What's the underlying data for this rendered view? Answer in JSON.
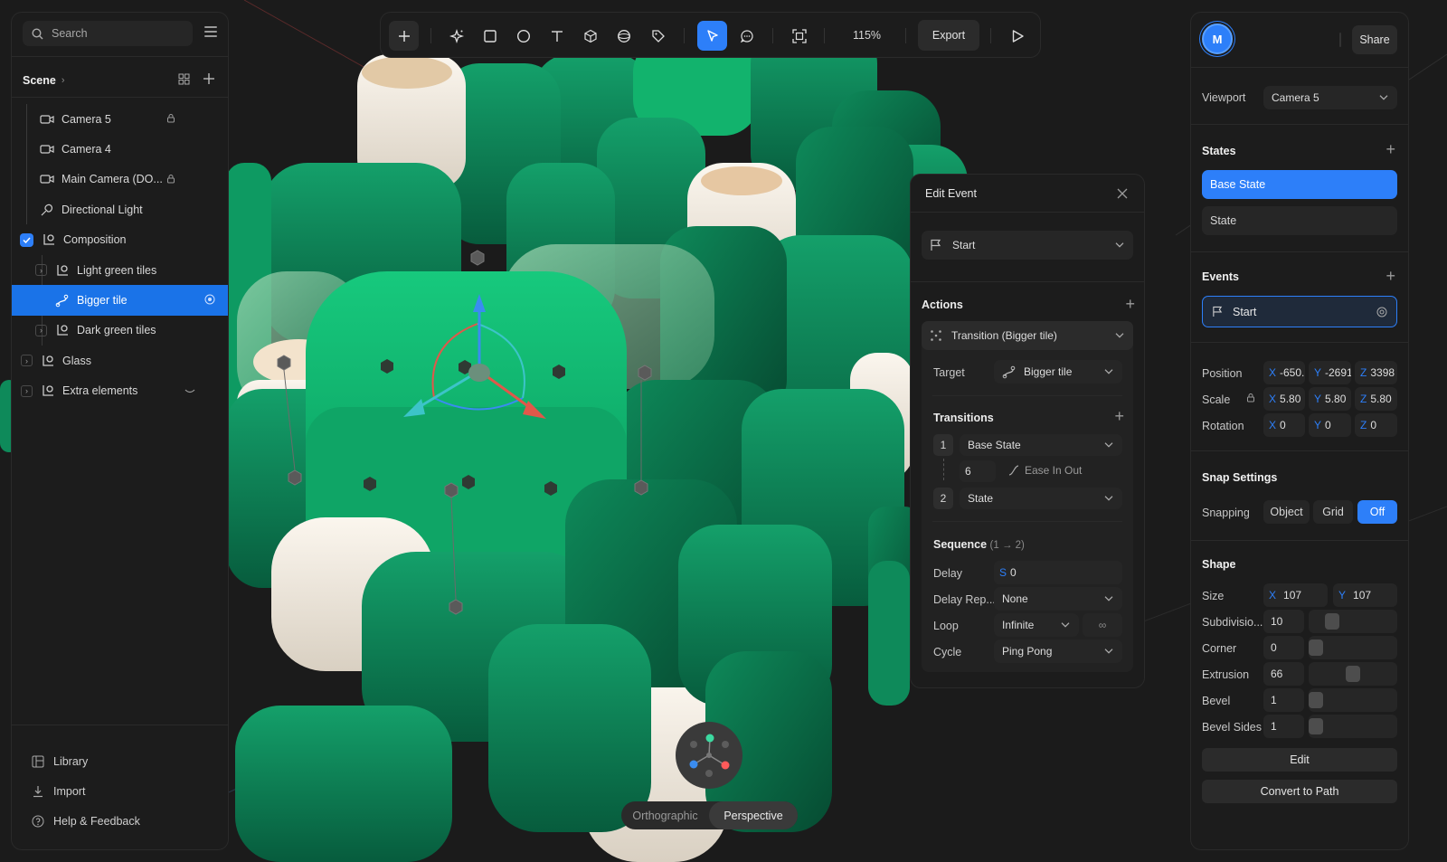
{
  "left_panel": {
    "search_placeholder": "Search",
    "scene_title": "Scene",
    "tree": [
      {
        "label": "Camera 5",
        "icon": "camera-icon",
        "locked": true
      },
      {
        "label": "Camera 4",
        "icon": "camera-icon",
        "locked": false
      },
      {
        "label": "Main Camera (DO...",
        "icon": "camera-icon",
        "locked": true
      },
      {
        "label": "Directional Light",
        "icon": "light-icon",
        "locked": false
      },
      {
        "label": "Composition",
        "icon": "group-icon",
        "checked": true
      },
      {
        "label": "Light green tiles",
        "icon": "group-icon"
      },
      {
        "label": "Bigger tile",
        "icon": "path-icon",
        "selected": true
      },
      {
        "label": "Dark green tiles",
        "icon": "group-icon"
      },
      {
        "label": "Glass",
        "icon": "group-icon"
      },
      {
        "label": "Extra elements",
        "icon": "group-icon",
        "hidden": true
      }
    ],
    "bottom_links": [
      "Library",
      "Import",
      "Help & Feedback"
    ]
  },
  "toolbar": {
    "zoom": "115%",
    "export_label": "Export",
    "tools": [
      "add-icon",
      "magic-icon",
      "rectangle-icon",
      "ellipse-icon",
      "text-icon",
      "cube-icon",
      "sphere-icon",
      "tag-icon",
      "pointer-icon",
      "comment-icon",
      "frame-icon",
      "play-icon"
    ],
    "active_tool": "pointer-icon"
  },
  "right_panel": {
    "avatar_initial": "M",
    "share_label": "Share",
    "viewport_label": "Viewport",
    "viewport_value": "Camera 5",
    "states_heading": "States",
    "states": [
      "Base State",
      "State"
    ],
    "events_heading": "Events",
    "event": "Start",
    "position_label": "Position",
    "position": {
      "x": "-650.",
      "y": "-2691",
      "z": "3398"
    },
    "scale_label": "Scale",
    "scale": {
      "x": "5.80",
      "y": "5.80",
      "z": "5.80"
    },
    "rotation_label": "Rotation",
    "rotation": {
      "x": "0",
      "y": "0",
      "z": "0"
    },
    "snap_heading": "Snap Settings",
    "snapping_label": "Snapping",
    "snap_options": [
      "Object",
      "Grid",
      "Off"
    ],
    "snap_active": "Off",
    "shape_heading": "Shape",
    "size_label": "Size",
    "size": {
      "x": "107",
      "y": "107"
    },
    "subdivisions_label": "Subdivisio...",
    "subdivisions": "10",
    "corner_label": "Corner",
    "corner": "0",
    "extrusion_label": "Extrusion",
    "extrusion": "66",
    "bevel_label": "Bevel",
    "bevel": "1",
    "bevel_sides_label": "Bevel Sides",
    "bevel_sides": "1",
    "edit_label": "Edit",
    "convert_label": "Convert to Path"
  },
  "edit_event": {
    "title": "Edit Event",
    "trigger": "Start",
    "actions_heading": "Actions",
    "action": "Transition (Bigger tile)",
    "target_label": "Target",
    "target_value": "Bigger tile",
    "transitions_heading": "Transitions",
    "transition_1_num": "1",
    "transition_1_state": "Base State",
    "duration": "6",
    "easing": "Ease In Out",
    "transition_2_num": "2",
    "transition_2_state": "State",
    "sequence_heading": "Sequence",
    "sequence_range": "(1 → 2)",
    "delay_label": "Delay",
    "delay_unit": "S",
    "delay_value": "0",
    "delay_repeat_label": "Delay Rep...",
    "delay_repeat_value": "None",
    "loop_label": "Loop",
    "loop_value": "Infinite",
    "loop_symbol": "∞",
    "cycle_label": "Cycle",
    "cycle_value": "Ping Pong"
  },
  "view_switch": {
    "options": [
      "Orthographic",
      "Perspective"
    ],
    "active": "Perspective"
  },
  "colors": {
    "accent": "#2d7ff9",
    "selection": "#1a73e8",
    "tile_green": "#0fa566",
    "tile_dark": "#0b6b48",
    "tile_cream": "#f1ebe1"
  }
}
